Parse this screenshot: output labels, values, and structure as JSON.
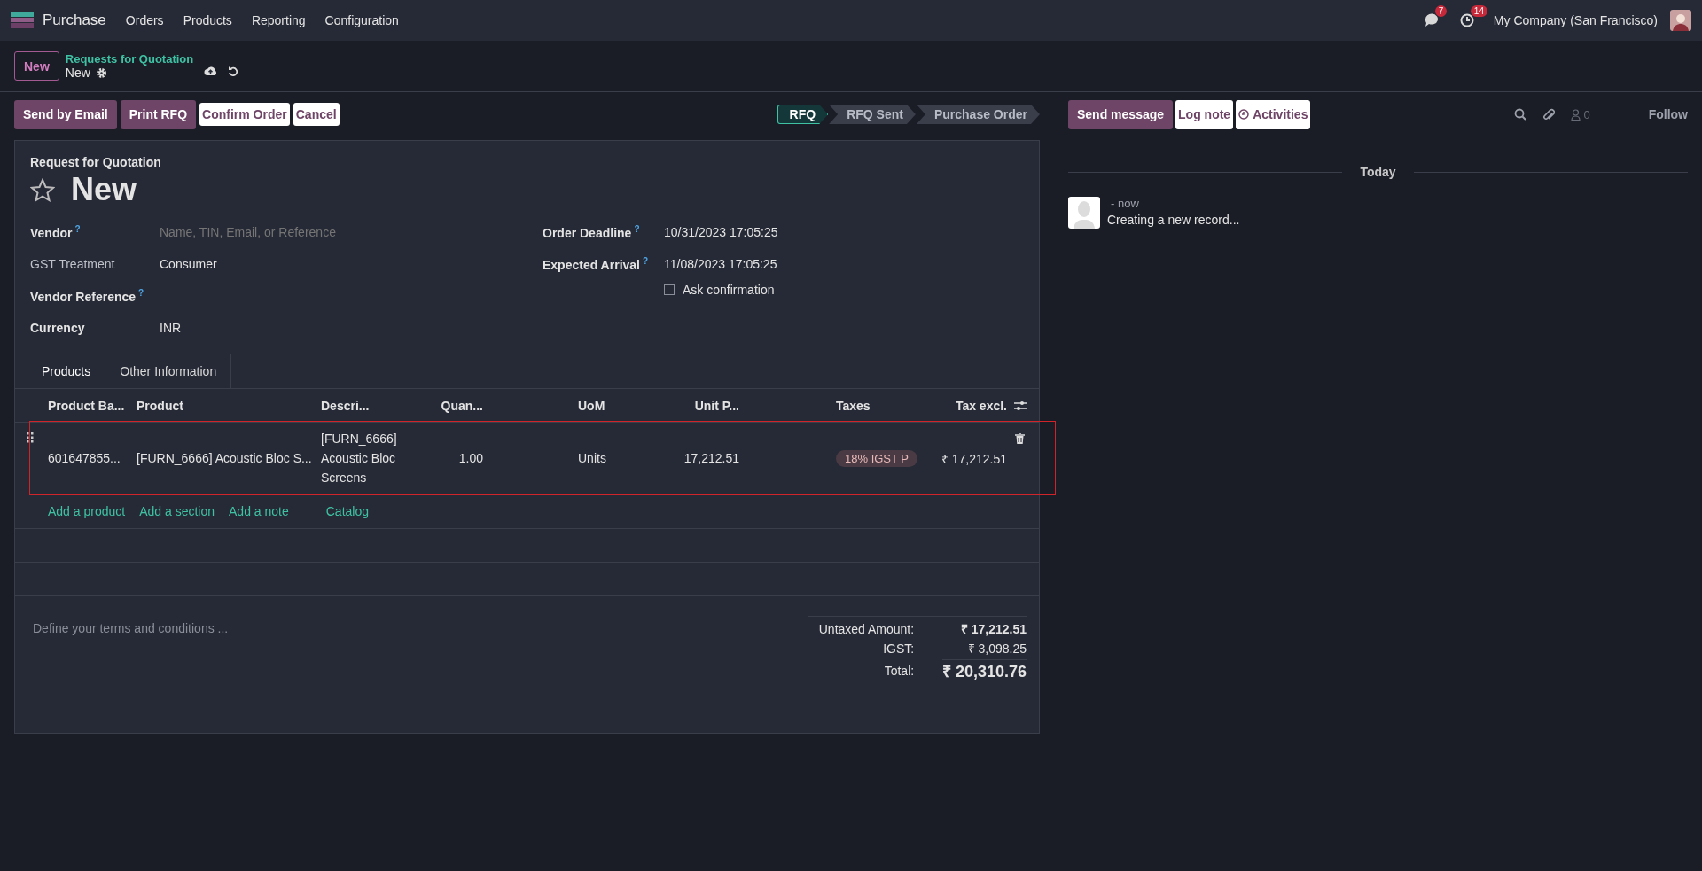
{
  "navbar": {
    "app": "Purchase",
    "menu": [
      "Orders",
      "Products",
      "Reporting",
      "Configuration"
    ],
    "messages_badge": "7",
    "activities_badge": "14",
    "company": "My Company (San Francisco)"
  },
  "control_panel": {
    "new_button": "New",
    "breadcrumb": "Requests for Quotation",
    "record": "New"
  },
  "actions": [
    {
      "label": "Send by Email",
      "kind": "primary"
    },
    {
      "label": "Print RFQ",
      "kind": "primary"
    },
    {
      "label": "Confirm Order",
      "kind": "secondary"
    },
    {
      "label": "Cancel",
      "kind": "secondary"
    }
  ],
  "statusbar": [
    {
      "label": "RFQ",
      "selected": true
    },
    {
      "label": "RFQ Sent",
      "selected": false
    },
    {
      "label": "Purchase Order",
      "selected": false
    }
  ],
  "form": {
    "subtitle": "Request for Quotation",
    "title": "New",
    "starred": false,
    "left_fields": [
      {
        "label": "Vendor",
        "help": "?",
        "placeholder": "Name, TIN, Email, or Reference",
        "readonly": false
      },
      {
        "label": "GST Treatment",
        "value": "Consumer",
        "readonly": true
      },
      {
        "label": "Vendor Reference",
        "help": "?",
        "readonly": false
      },
      {
        "label": "Currency",
        "value": "INR",
        "readonly": false
      }
    ],
    "right_fields": [
      {
        "label": "Order Deadline",
        "help": "?",
        "value": "10/31/2023 17:05:25"
      },
      {
        "label": "Expected Arrival",
        "help": "?",
        "value": "11/08/2023 17:05:25"
      }
    ],
    "ask_confirmation": {
      "label": "Ask confirmation",
      "checked": false
    },
    "tabs": [
      {
        "label": "Products",
        "selected": true
      },
      {
        "label": "Other Information",
        "selected": false
      }
    ],
    "table": {
      "columns": [
        "Product Ba...",
        "Product",
        "Descri...",
        "Quan...",
        "UoM",
        "Unit P...",
        "Taxes",
        "Tax excl."
      ],
      "rows": [
        {
          "barcode": "601647855...",
          "product": "[FURN_6666] Acoustic Bloc S...",
          "description": "[FURN_6666] Acoustic Bloc Screens",
          "quantity": "1.00",
          "uom": "Units",
          "unit_price": "17,212.51",
          "taxes": [
            "18% IGST P"
          ],
          "subtotal": "₹ 17,212.51",
          "selected": true
        }
      ]
    },
    "add_links": [
      "Add a product",
      "Add a section",
      "Add a note",
      "Catalog"
    ],
    "terms_placeholder": "Define your terms and conditions ...",
    "totals": [
      {
        "label": "Untaxed Amount:",
        "value": "₹ 17,212.51",
        "kind": "subtotal"
      },
      {
        "label": "IGST:",
        "value": "₹ 3,098.25",
        "kind": "tax"
      },
      {
        "label": "Total:",
        "value": "₹ 20,310.76",
        "kind": "total"
      }
    ]
  },
  "chatter": {
    "buttons": [
      {
        "label": "Send message",
        "kind": "primary"
      },
      {
        "label": "Log note",
        "kind": "secondary"
      },
      {
        "label": "Activities",
        "kind": "activities"
      }
    ],
    "followers_count": "0",
    "follow": "Follow",
    "date_separator": "Today",
    "messages": [
      {
        "time": "- now",
        "body": "Creating a new record..."
      }
    ]
  }
}
